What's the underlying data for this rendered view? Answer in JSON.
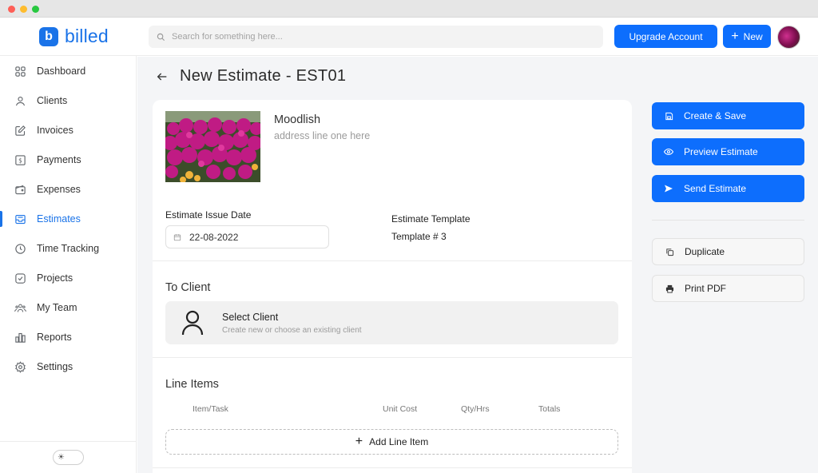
{
  "app": {
    "logo_letter": "b",
    "logo_text": "billed"
  },
  "header": {
    "search_placeholder": "Search for something here...",
    "upgrade_label": "Upgrade Account",
    "new_label": "New"
  },
  "sidebar": {
    "items": [
      {
        "label": "Dashboard",
        "icon": "grid-icon"
      },
      {
        "label": "Clients",
        "icon": "user-icon"
      },
      {
        "label": "Invoices",
        "icon": "edit-icon"
      },
      {
        "label": "Payments",
        "icon": "dollar-icon"
      },
      {
        "label": "Expenses",
        "icon": "wallet-icon"
      },
      {
        "label": "Estimates",
        "icon": "inbox-icon",
        "active": true
      },
      {
        "label": "Time Tracking",
        "icon": "clock-icon"
      },
      {
        "label": "Projects",
        "icon": "check-square-icon"
      },
      {
        "label": "My Team",
        "icon": "team-icon"
      },
      {
        "label": "Reports",
        "icon": "bar-chart-icon"
      },
      {
        "label": "Settings",
        "icon": "gear-icon"
      }
    ],
    "theme_icon": "sun-icon"
  },
  "page": {
    "title": "New Estimate - EST01"
  },
  "estimate": {
    "company_name": "Moodlish",
    "company_address": "address line one here",
    "issue_date_label": "Estimate Issue Date",
    "issue_date_value": "22-08-2022",
    "template_label": "Estimate Template",
    "template_value": "Template # 3",
    "to_client_title": "To Client",
    "select_client_title": "Select Client",
    "select_client_subtitle": "Create new or choose an existing client",
    "line_items_title": "Line Items",
    "columns": [
      "Item/Task",
      "Unit Cost",
      "Qty/Hrs",
      "Totals"
    ],
    "add_line_label": "Add Line Item"
  },
  "actions": {
    "create_save": "Create & Save",
    "preview": "Preview Estimate",
    "send": "Send Estimate",
    "duplicate": "Duplicate",
    "print_pdf": "Print PDF"
  },
  "colors": {
    "brand": "#1a73e8",
    "button_primary": "#0d6efd",
    "main_bg": "#f4f5f7"
  }
}
